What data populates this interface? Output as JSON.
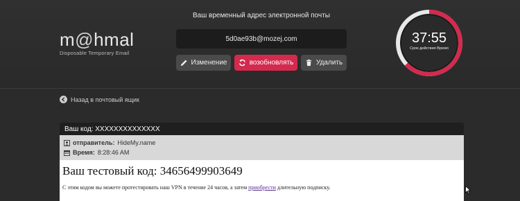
{
  "logo": {
    "prefix": "m",
    "at": "@",
    "suffix": "hmal",
    "tagline": "Disposable Temporary Email"
  },
  "email": {
    "label": "Ваш временный адрес электронной почты",
    "address": "5d0ae93b@mozej.com"
  },
  "buttons": {
    "edit": "Изменение",
    "refresh": "возобновлять",
    "delete": "Удалить"
  },
  "timer": {
    "value": "37:55",
    "label": "Срок действия Время",
    "remaining_fraction": 0.63
  },
  "nav": {
    "back": "Назад в почтовый ящик"
  },
  "message": {
    "subject": "Ваш код: XXXXXXXXXXXXXX",
    "sender_label": "отправитель:",
    "sender": "HideMy.name",
    "time_label": "Время:",
    "time": "8:28:46 AM",
    "heading": "Ваш тестовый код: 34656499903649",
    "body_before": "С этим кодом вы можете протестировать наш VPN в течение 24 часов, а затем ",
    "body_link": "приобрести",
    "body_after": " длительную подписку."
  },
  "colors": {
    "accent": "#d42a4e",
    "background": "#2b2b2b"
  }
}
